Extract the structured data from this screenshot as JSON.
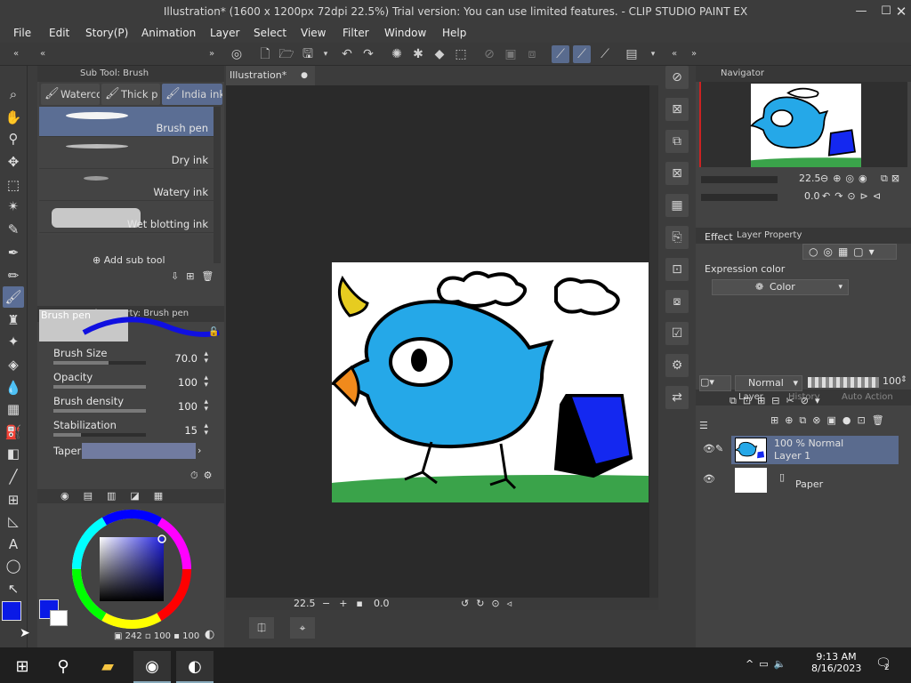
{
  "window": {
    "title": "Illustration* (1600 x 1200px 72dpi 22.5%)  Trial version: You can use limited features. - CLIP STUDIO PAINT EX"
  },
  "menu": [
    "File",
    "Edit",
    "Story(P)",
    "Animation",
    "Layer",
    "Select",
    "View",
    "Filter",
    "Window",
    "Help"
  ],
  "subtool": {
    "header": "Sub Tool: Brush",
    "tabs": [
      "Waterco",
      "Thick p",
      "India ink"
    ],
    "brushes": [
      "Brush pen",
      "Dry ink",
      "Watery ink",
      "Wet blotting ink"
    ],
    "add_label": "Add sub tool"
  },
  "toolprop": {
    "header": "Tool property: Brush pen",
    "preview_label": "Brush pen",
    "brush_size_label": "Brush Size",
    "brush_size": "70.0",
    "brush_size_level": 0.6,
    "opacity_label": "Opacity",
    "opacity": "100",
    "opacity_level": 1.0,
    "density_label": "Brush density",
    "density": "100",
    "density_level": 1.0,
    "stabilization_label": "Stabilization",
    "stabilization": "15",
    "stabilization_level": 0.3,
    "taper_label": "Taper"
  },
  "color": {
    "main": "#0a1ae6",
    "sub": "#ffffff",
    "readout": "242",
    "readout2": "100",
    "readout3": "100"
  },
  "canvas": {
    "tab": "Illustration*",
    "zoom": "22.5",
    "rotation": "0.0"
  },
  "navigator": {
    "header": "Navigator",
    "zoom": "22.5",
    "rotation": "0.0"
  },
  "layerprop": {
    "header": "Layer Property",
    "effect_label": "Effect",
    "expression_label": "Expression color",
    "expression_value": "Color"
  },
  "layerpanel": {
    "header": "Layer",
    "header2": "History",
    "header3": "Auto Action",
    "blend": "Normal",
    "opacity": "100",
    "layers": [
      {
        "line1": "100 % Normal",
        "line2": "Layer 1"
      },
      {
        "line1": "Paper",
        "line2": ""
      }
    ]
  },
  "taskbar": {
    "time": "9:13 AM",
    "date": "8/16/2023",
    "notif": "2"
  }
}
